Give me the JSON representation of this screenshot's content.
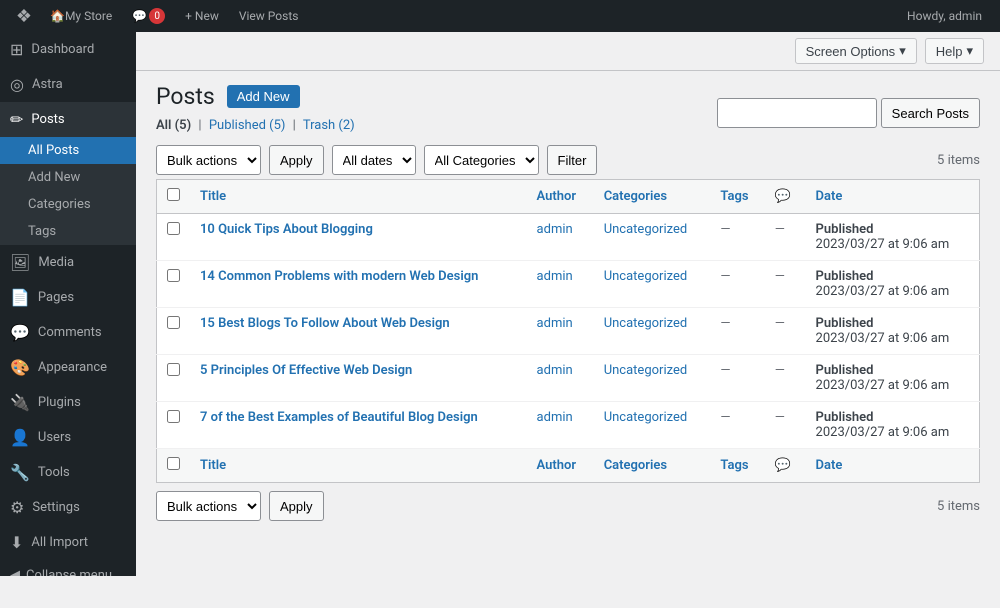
{
  "adminBar": {
    "wpLogo": "❖",
    "storeName": "My Store",
    "commentsIcon": "💬",
    "commentCount": "0",
    "newLabel": "+ New",
    "viewPostsLabel": "View Posts",
    "howdy": "Howdy, admin"
  },
  "screenOptions": {
    "label": "Screen Options",
    "chevron": "▾"
  },
  "help": {
    "label": "Help",
    "chevron": "▾"
  },
  "page": {
    "title": "Posts",
    "addNewLabel": "Add New"
  },
  "filterTabs": [
    {
      "label": "All",
      "count": "(5)",
      "active": true
    },
    {
      "label": "Published",
      "count": "(5)",
      "active": false
    },
    {
      "label": "Trash",
      "count": "(2)",
      "active": false
    }
  ],
  "toolbar": {
    "bulkActionsLabel": "Bulk actions",
    "applyLabel": "Apply",
    "dateLabel": "All dates",
    "categoryLabel": "All Categories",
    "filterLabel": "Filter",
    "itemCount": "5 items"
  },
  "search": {
    "placeholder": "",
    "buttonLabel": "Search Posts"
  },
  "tableHeaders": {
    "title": "Title",
    "author": "Author",
    "categories": "Categories",
    "tags": "Tags",
    "comments": "💬",
    "date": "Date"
  },
  "posts": [
    {
      "id": 1,
      "title": "10 Quick Tips About Blogging",
      "author": "admin",
      "category": "Uncategorized",
      "tags": "—",
      "comments": "—",
      "status": "Published",
      "date": "2023/03/27 at 9:06 am"
    },
    {
      "id": 2,
      "title": "14 Common Problems with modern Web Design",
      "author": "admin",
      "category": "Uncategorized",
      "tags": "—",
      "comments": "—",
      "status": "Published",
      "date": "2023/03/27 at 9:06 am"
    },
    {
      "id": 3,
      "title": "15 Best Blogs To Follow About Web Design",
      "author": "admin",
      "category": "Uncategorized",
      "tags": "—",
      "comments": "—",
      "status": "Published",
      "date": "2023/03/27 at 9:06 am"
    },
    {
      "id": 4,
      "title": "5 Principles Of Effective Web Design",
      "author": "admin",
      "category": "Uncategorized",
      "tags": "—",
      "comments": "—",
      "status": "Published",
      "date": "2023/03/27 at 9:06 am"
    },
    {
      "id": 5,
      "title": "7 of the Best Examples of Beautiful Blog Design",
      "author": "admin",
      "category": "Uncategorized",
      "tags": "—",
      "comments": "—",
      "status": "Published",
      "date": "2023/03/27 at 9:06 am"
    }
  ],
  "sidebar": {
    "dashboard": "Dashboard",
    "astra": "Astra",
    "posts": "Posts",
    "postsSubmenu": {
      "allPosts": "All Posts",
      "addNew": "Add New",
      "categories": "Categories",
      "tags": "Tags"
    },
    "media": "Media",
    "pages": "Pages",
    "comments": "Comments",
    "appearance": "Appearance",
    "plugins": "Plugins",
    "users": "Users",
    "tools": "Tools",
    "settings": "Settings",
    "allImport": "All Import",
    "collapseMenu": "Collapse menu"
  },
  "bottomToolbar": {
    "bulkActionsLabel": "Bulk actions",
    "applyLabel": "Apply",
    "itemCount": "5 items"
  }
}
